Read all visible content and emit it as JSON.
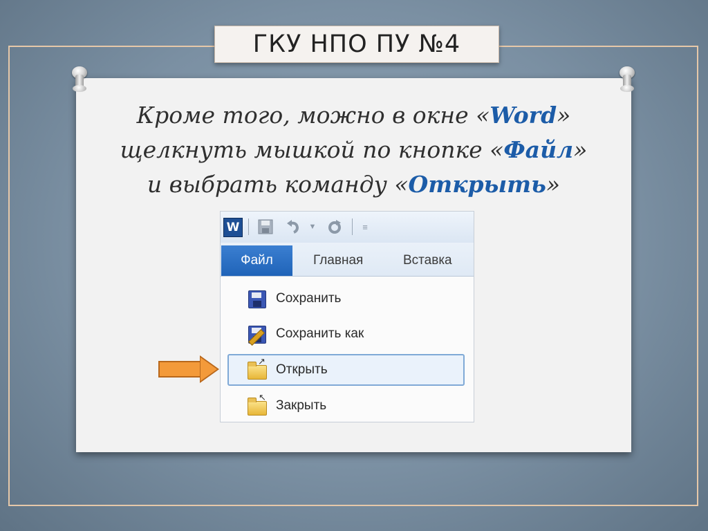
{
  "slide": {
    "title": "ГКУ НПО ПУ №4",
    "paragraph": {
      "line1_before": "Кроме того, можно в окне «",
      "line1_hl": "Word",
      "line1_after": "»",
      "line2_before": "щелкнуть мышкой по кнопке «",
      "line2_hl": "Файл",
      "line2_after": "»",
      "line3_before": "и выбрать команду «",
      "line3_hl": "Открыть",
      "line3_after": "»"
    }
  },
  "word_screenshot": {
    "logo": "W",
    "tabs": {
      "file": "Файл",
      "home": "Главная",
      "insert": "Вставка"
    },
    "menu_items": [
      {
        "label": "Сохранить",
        "icon": "save-icon"
      },
      {
        "label": "Сохранить как",
        "icon": "save-as-icon"
      },
      {
        "label": "Открыть",
        "icon": "open-folder-icon",
        "selected": true
      },
      {
        "label": "Закрыть",
        "icon": "close-folder-icon"
      }
    ]
  },
  "colors": {
    "accent_text": "#1c5ca8",
    "file_tab": "#2a6fc4",
    "pointer_arrow": "#f39a3a"
  }
}
